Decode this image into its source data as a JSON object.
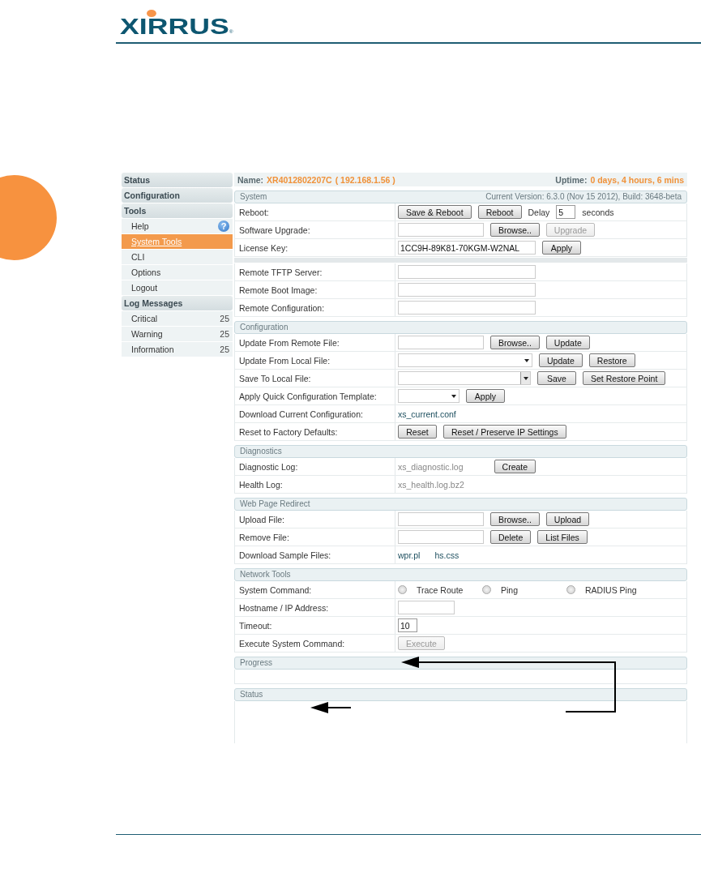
{
  "logo": {
    "text": "XIRRUS",
    "mark": "®"
  },
  "sidebar": [
    {
      "label": "Status"
    },
    {
      "label": "Configuration"
    },
    {
      "label": "Tools",
      "items": [
        {
          "label": "Help",
          "help_icon": "?",
          "selected": false
        },
        {
          "label": "System Tools",
          "selected": true
        },
        {
          "label": "CLI",
          "selected": false
        },
        {
          "label": "Options",
          "selected": false
        },
        {
          "label": "Logout",
          "selected": false
        }
      ]
    },
    {
      "label": "Log Messages",
      "items": [
        {
          "label": "Critical",
          "count": "25",
          "selected": false
        },
        {
          "label": "Warning",
          "count": "25",
          "selected": false
        },
        {
          "label": "Information",
          "count": "25",
          "selected": false
        }
      ]
    }
  ],
  "header": {
    "name_label": "Name:",
    "name": "XR4012802207C",
    "ip": "( 192.168.1.56 )",
    "uptime_label": "Uptime:",
    "uptime": "0 days, 4 hours, 6 mins"
  },
  "sections": [
    {
      "kind": "form",
      "title": "System",
      "info": "Current Version: 6.3.0 (Nov 15 2012), Build: 3648-beta",
      "rows": [
        {
          "kind": "row",
          "label": "Reboot:",
          "items": [
            {
              "kind": "button",
              "label": "Save & Reboot",
              "disabled": false
            },
            {
              "kind": "button",
              "label": "Reboot",
              "disabled": false
            },
            {
              "kind": "text",
              "text": "Delay"
            },
            {
              "kind": "field-tiny",
              "value": "5"
            },
            {
              "kind": "text",
              "text": "seconds"
            }
          ]
        },
        {
          "kind": "row",
          "label": "Software Upgrade:",
          "items": [
            {
              "kind": "field-file"
            },
            {
              "kind": "button",
              "label": "Browse..",
              "disabled": false
            },
            {
              "kind": "button",
              "label": "Upgrade",
              "disabled": true
            }
          ]
        },
        {
          "kind": "row",
          "label": "License Key:",
          "items": [
            {
              "kind": "field-long",
              "value": "1CC9H-89K81-70KGM-W2NAL"
            },
            {
              "kind": "button",
              "label": "Apply",
              "disabled": false
            }
          ]
        },
        {
          "kind": "separator"
        },
        {
          "kind": "row",
          "label": "Remote TFTP Server:",
          "items": [
            {
              "kind": "field-long"
            }
          ]
        },
        {
          "kind": "row",
          "label": "Remote Boot Image:",
          "items": [
            {
              "kind": "field-long"
            }
          ]
        },
        {
          "kind": "row",
          "label": "Remote Configuration:",
          "items": [
            {
              "kind": "field-long"
            }
          ]
        }
      ]
    },
    {
      "kind": "form",
      "title": "Configuration",
      "rows": [
        {
          "kind": "row",
          "label": "Update From Remote File:",
          "items": [
            {
              "kind": "field-file"
            },
            {
              "kind": "button",
              "label": "Browse..",
              "disabled": false
            },
            {
              "kind": "button",
              "label": "Update",
              "disabled": false
            }
          ]
        },
        {
          "kind": "row",
          "label": "Update From Local File:",
          "items": [
            {
              "kind": "select-long"
            },
            {
              "kind": "button",
              "label": "Update",
              "disabled": false
            },
            {
              "kind": "button",
              "label": "Restore",
              "disabled": false
            }
          ]
        },
        {
          "kind": "row",
          "label": "Save To Local File:",
          "items": [
            {
              "kind": "combo"
            },
            {
              "kind": "button",
              "label": "Save",
              "disabled": false
            },
            {
              "kind": "button",
              "label": "Set Restore Point",
              "disabled": false
            }
          ]
        },
        {
          "kind": "row",
          "label": "Apply Quick Configuration Template:",
          "items": [
            {
              "kind": "select-short"
            },
            {
              "kind": "button",
              "label": "Apply",
              "disabled": false
            }
          ]
        },
        {
          "kind": "row",
          "label": "Download Current Configuration:",
          "items": [
            {
              "kind": "link",
              "text": "xs_current.conf"
            }
          ]
        },
        {
          "kind": "row",
          "label": "Reset to Factory Defaults:",
          "items": [
            {
              "kind": "button",
              "label": "Reset",
              "disabled": false
            },
            {
              "kind": "button",
              "label": "Reset / Preserve IP Settings",
              "disabled": false
            }
          ]
        }
      ]
    },
    {
      "kind": "form",
      "title": "Diagnostics",
      "rows": [
        {
          "kind": "row",
          "label": "Diagnostic Log:",
          "items": [
            {
              "kind": "file-name",
              "text": "xs_diagnostic.log"
            },
            {
              "kind": "button",
              "label": "Create",
              "disabled": false
            }
          ]
        },
        {
          "kind": "row",
          "label": "Health Log:",
          "items": [
            {
              "kind": "file-name",
              "text": "xs_health.log.bz2"
            }
          ]
        }
      ]
    },
    {
      "kind": "form",
      "title": "Web Page Redirect",
      "rows": [
        {
          "kind": "row",
          "label": "Upload File:",
          "items": [
            {
              "kind": "field-file"
            },
            {
              "kind": "button",
              "label": "Browse..",
              "disabled": false
            },
            {
              "kind": "button",
              "label": "Upload",
              "disabled": false
            }
          ]
        },
        {
          "kind": "row",
          "label": "Remove File:",
          "items": [
            {
              "kind": "field-file"
            },
            {
              "kind": "button",
              "label": "Delete",
              "disabled": false
            },
            {
              "kind": "button",
              "label": "List Files",
              "disabled": false
            }
          ]
        },
        {
          "kind": "row",
          "label": "Download Sample Files:",
          "items": [
            {
              "kind": "link",
              "text": "wpr.pl"
            },
            {
              "kind": "link",
              "text": "hs.css"
            }
          ]
        }
      ]
    },
    {
      "kind": "form",
      "title": "Network Tools",
      "rows": [
        {
          "kind": "row",
          "label": "System Command:",
          "items": [
            {
              "kind": "radio",
              "label": "Trace Route",
              "selected": false
            },
            {
              "kind": "radio",
              "label": "Ping",
              "selected": false
            },
            {
              "kind": "radio",
              "label": "RADIUS Ping",
              "selected": false
            }
          ]
        },
        {
          "kind": "row",
          "label": "Hostname / IP Address:",
          "items": [
            {
              "kind": "field-short"
            }
          ]
        },
        {
          "kind": "row",
          "label": "Timeout:",
          "items": [
            {
              "kind": "field-tiny",
              "value": "10"
            }
          ]
        },
        {
          "kind": "row",
          "label": "Execute System Command:",
          "items": [
            {
              "kind": "button",
              "label": "Execute",
              "disabled": true
            }
          ]
        }
      ]
    },
    {
      "kind": "progress-area",
      "title": "Progress"
    },
    {
      "kind": "output-area",
      "title": "Status"
    }
  ]
}
